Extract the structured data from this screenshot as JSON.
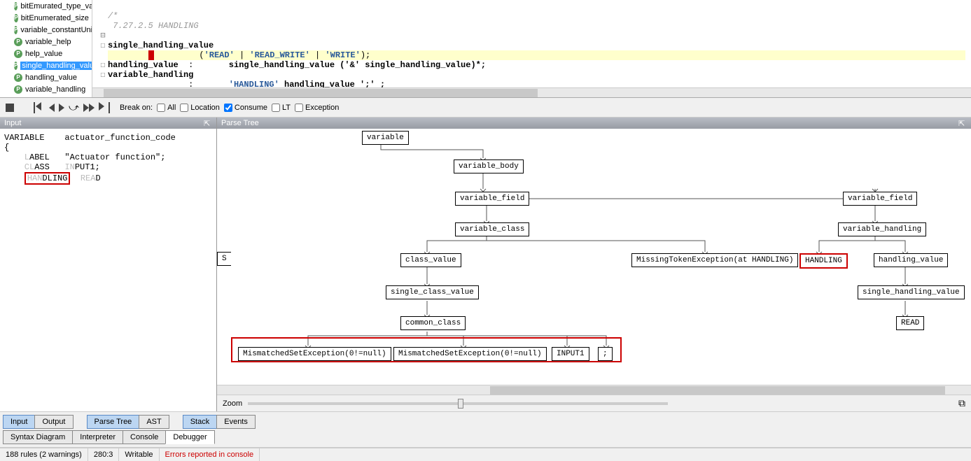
{
  "rules": [
    {
      "icon": "P",
      "label": "bitEmurated_type_value",
      "selected": false
    },
    {
      "icon": "P",
      "label": "bitEnumerated_size",
      "selected": false
    },
    {
      "icon": "P",
      "label": "variable_constantUnit",
      "selected": false
    },
    {
      "icon": "P",
      "label": "variable_help",
      "selected": false
    },
    {
      "icon": "P",
      "label": "help_value",
      "selected": false
    },
    {
      "icon": "P",
      "label": "single_handling_value",
      "selected": true
    },
    {
      "icon": "P",
      "label": "handling_value",
      "selected": false
    },
    {
      "icon": "P",
      "label": "variable_handling",
      "selected": false
    }
  ],
  "code": {
    "comment1": "/*",
    "comment2": " 7.27.2.5 HANDLING",
    "line3_name": "single_handling_value",
    "line4_rhs_a": "'READ'",
    "line4_rhs_b": "'READ_WRITE'",
    "line4_rhs_c": "'WRITE'",
    "line4_tail": ");",
    "line5_name": "handling_value",
    "line5_colon": ":",
    "line5_rhs": "single_handling_value ('&' single_handling_value)*;",
    "line6_name": "variable_handling",
    "line7_colon": ":",
    "line7_lit": "'HANDLING'",
    "line7_rest": " handling_value ';' ;"
  },
  "toolbar": {
    "break_on": "Break on:",
    "all": "All",
    "location": "Location",
    "consume": "Consume",
    "lt": "LT",
    "exception": "Exception"
  },
  "panels": {
    "input": "Input",
    "parse_tree": "Parse Tree"
  },
  "input_text": {
    "line1a": "VARIABLE",
    "line1b": "actuator_function_code",
    "line2": "{",
    "line3_faded": "    L",
    "line3_rest": "ABEL   \"Actuator function\";",
    "line4_faded": "    CL",
    "line4_mid": "ASS   ",
    "line4_faded2": "IN",
    "line4_end": "PUT1;",
    "line5_box": "HANDLING",
    "line5_faded": "  REA",
    "line5_end": "D"
  },
  "tree": {
    "variable": "variable",
    "variable_body": "variable_body",
    "variable_field1": "variable_field",
    "variable_field2": "variable_field",
    "variable_class": "variable_class",
    "variable_handling": "variable_handling",
    "class_value": "class_value",
    "missing_token": "MissingTokenException(at HANDLING)",
    "handling_lit": "HANDLING",
    "handling_value": "handling_value",
    "single_class_value": "single_class_value",
    "single_handling_value": "single_handling_value",
    "common_class": "common_class",
    "read": "READ",
    "mis1": "MismatchedSetException(0!=null)",
    "mis2": "MismatchedSetException(0!=null)",
    "input1": "INPUT1",
    "semi": ";"
  },
  "zoom_label": "Zoom",
  "tabs1": {
    "input": "Input",
    "output": "Output",
    "parse_tree": "Parse Tree",
    "ast": "AST",
    "stack": "Stack",
    "events": "Events"
  },
  "tabs2": {
    "syntax": "Syntax Diagram",
    "interpreter": "Interpreter",
    "console": "Console",
    "debugger": "Debugger"
  },
  "status": {
    "rules": "188 rules (2 warnings)",
    "pos": "280:3",
    "writable": "Writable",
    "errors": "Errors reported in console"
  }
}
